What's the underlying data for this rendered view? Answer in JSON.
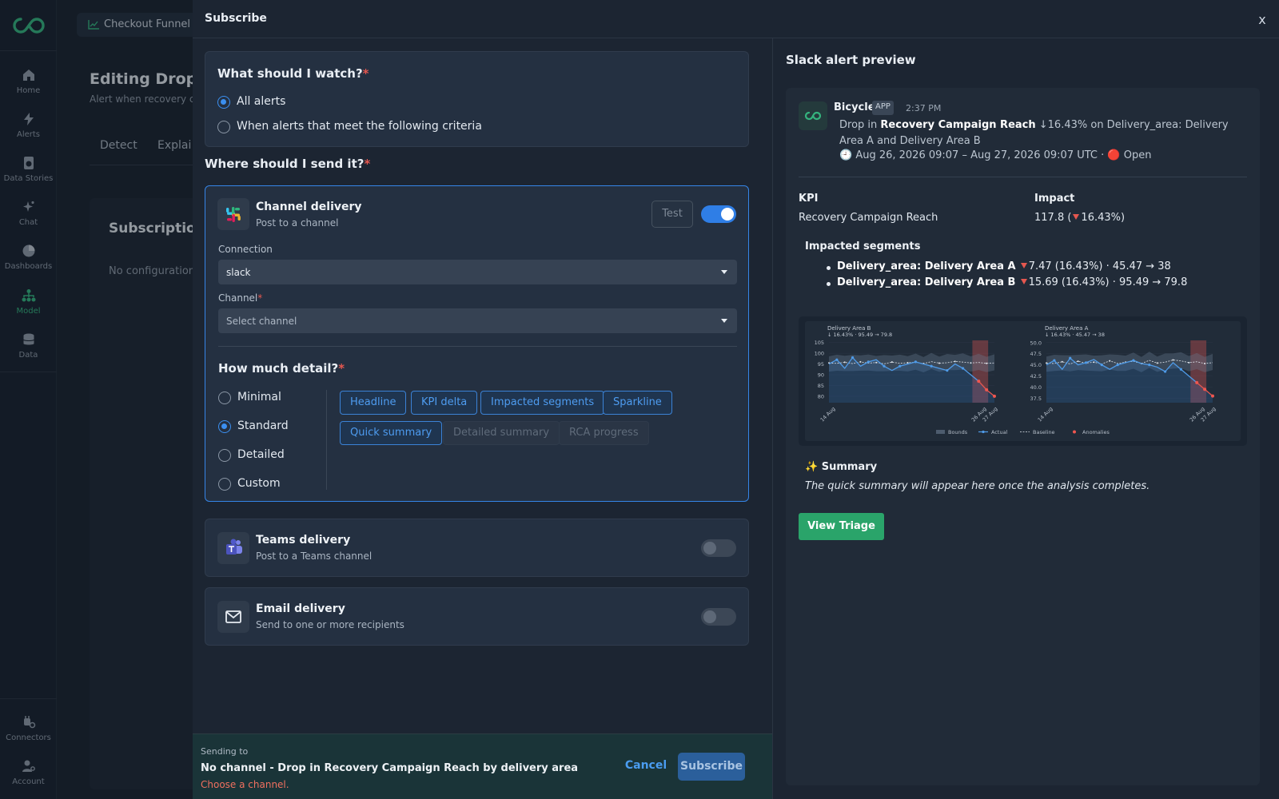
{
  "sidebar": {
    "items": [
      {
        "label": "Home",
        "icon": "home-icon"
      },
      {
        "label": "Alerts",
        "icon": "bolt-icon"
      },
      {
        "label": "Data Stories",
        "icon": "data-stories-icon"
      },
      {
        "label": "Chat",
        "icon": "sparkle-icon"
      },
      {
        "label": "Dashboards",
        "icon": "pie-chart-icon"
      },
      {
        "label": "Model",
        "icon": "model-icon",
        "active": true
      },
      {
        "label": "Data",
        "icon": "database-icon"
      }
    ],
    "bottom": [
      {
        "label": "Connectors",
        "icon": "connectors-icon"
      },
      {
        "label": "Account",
        "icon": "account-icon"
      }
    ]
  },
  "background": {
    "breadcrumb": "Checkout Funnel O",
    "title": "Editing Drop in",
    "subtitle": "Alert when recovery cam",
    "tabs": [
      "Detect",
      "Explai"
    ],
    "card_title": "Subscriptions",
    "card_empty": "No configuration"
  },
  "modal": {
    "title": "Subscribe",
    "close": "x",
    "watch": {
      "question": "What should I watch?",
      "required": "*",
      "options": [
        "All alerts",
        "When alerts that meet the following criteria"
      ],
      "selected": 0
    },
    "send": {
      "question": "Where should I send it?",
      "required": "*"
    },
    "channel": {
      "title": "Channel delivery",
      "subtitle": "Post to a channel",
      "test_label": "Test",
      "enabled": true,
      "connection_label": "Connection",
      "connection_value": "slack",
      "channel_label": "Channel",
      "channel_required": "*",
      "channel_placeholder": "Select channel",
      "detail_question": "How much detail?",
      "detail_required": "*",
      "detail_options": [
        "Minimal",
        "Standard",
        "Detailed",
        "Custom"
      ],
      "detail_selected": 1,
      "chips_active": [
        "Headline",
        "KPI delta",
        "Impacted segments",
        "Sparkline",
        "Quick summary"
      ],
      "chips_inactive": [
        "Detailed summary",
        "RCA progress"
      ]
    },
    "teams": {
      "title": "Teams delivery",
      "subtitle": "Post to a Teams channel",
      "enabled": false
    },
    "email": {
      "title": "Email delivery",
      "subtitle": "Send to one or more recipients",
      "enabled": false
    },
    "footer": {
      "label": "Sending to",
      "target": "No channel - Drop in Recovery Campaign Reach by delivery area",
      "error": "Choose a channel.",
      "cancel": "Cancel",
      "subscribe": "Subscribe"
    }
  },
  "preview": {
    "title": "Slack alert preview",
    "bot_name": "Bicycle",
    "app_badge": "APP",
    "time": "2:37 PM",
    "message": {
      "prefix": "Drop in",
      "kpi": "Recovery Campaign Reach",
      "rest": "↓16.43% on Delivery_area: Delivery Area A and Delivery Area B",
      "window": "🕘 Aug 26, 2026 09:07 – Aug 27, 2026 09:07 UTC · 🔴 Open"
    },
    "kpi_label": "KPI",
    "kpi_value": "Recovery Campaign Reach",
    "impact_label": "Impact",
    "impact_value_a": "117.8 (",
    "impact_value_b": "16.43%)",
    "segments_title": "Impacted segments",
    "segments": [
      {
        "name": "Delivery_area: Delivery Area A",
        "stats": "7.47 (16.43%) · 45.47 → 38"
      },
      {
        "name": "Delivery_area: Delivery Area B",
        "stats": "15.69 (16.43%) · 95.49 → 79.8"
      }
    ],
    "summary_title": "✨ Summary",
    "summary_text": "The quick summary will appear here once the analysis completes.",
    "cta": "View Triage",
    "colors": {
      "accent": "#2f7ee6",
      "success": "#2aa46a",
      "danger": "#e5574f"
    }
  },
  "chart_data": [
    {
      "type": "line",
      "title": "Delivery Area B",
      "subtitle": "↓ 16.43% · 95.49 → 79.8",
      "x_ticks": [
        "14 Aug",
        "26 Aug",
        "27 Aug"
      ],
      "ylim": [
        77,
        106
      ],
      "y_ticks": [
        80,
        85,
        90,
        95,
        100,
        105
      ],
      "series": [
        {
          "name": "Actual",
          "values": [
            95,
            97,
            93,
            98,
            94,
            96,
            97,
            94,
            92,
            94,
            95,
            96,
            95,
            94,
            93,
            92,
            95,
            93,
            90,
            87,
            83,
            80
          ]
        },
        {
          "name": "Baseline",
          "values": [
            95.5,
            95.3,
            95.8,
            95.2,
            96,
            95.4,
            95.7,
            95.1,
            95.9,
            95.3,
            95.6,
            95.8,
            95.2,
            96.1,
            95.4,
            95.6,
            96.2,
            95.9,
            95.5,
            95.7,
            95.3,
            95.5
          ]
        },
        {
          "name": "Anomalies",
          "values": [
            null,
            null,
            null,
            null,
            null,
            null,
            null,
            null,
            null,
            null,
            null,
            null,
            null,
            null,
            null,
            null,
            null,
            null,
            null,
            87,
            83,
            80
          ]
        }
      ],
      "legend": [
        "Bounds",
        "Actual",
        "Baseline",
        "Anomalies"
      ]
    },
    {
      "type": "line",
      "title": "Delivery Area A",
      "subtitle": "↓ 16.43% · 45.47 → 38",
      "x_ticks": [
        "14 Aug",
        "26 Aug",
        "27 Aug"
      ],
      "ylim": [
        36.5,
        50.5
      ],
      "y_ticks": [
        37.5,
        40.0,
        42.5,
        45.0,
        47.5,
        50.0
      ],
      "series": [
        {
          "name": "Actual",
          "values": [
            45,
            46,
            44,
            46.5,
            45,
            45.5,
            46.2,
            45,
            44,
            45,
            45.5,
            46,
            45.3,
            45,
            44.5,
            43.5,
            45.5,
            44,
            42.5,
            41,
            39.5,
            38
          ]
        },
        {
          "name": "Baseline",
          "values": [
            45.4,
            45.3,
            45.7,
            45.2,
            45.8,
            45.4,
            45.6,
            45.2,
            45.9,
            45.3,
            45.6,
            45.8,
            45.3,
            46,
            45.4,
            45.6,
            46.1,
            45.9,
            45.5,
            45.7,
            45.3,
            45.5
          ]
        },
        {
          "name": "Anomalies",
          "values": [
            null,
            null,
            null,
            null,
            null,
            null,
            null,
            null,
            null,
            null,
            null,
            null,
            null,
            null,
            null,
            null,
            null,
            null,
            null,
            41,
            39.5,
            38
          ]
        }
      ],
      "legend": [
        "Bounds",
        "Actual",
        "Baseline",
        "Anomalies"
      ]
    }
  ]
}
